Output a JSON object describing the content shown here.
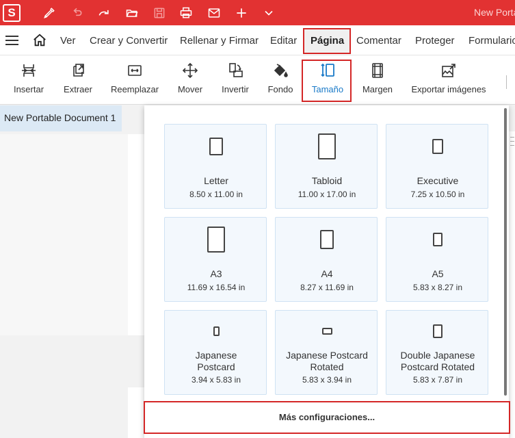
{
  "app": {
    "logo": "S",
    "document_title": "New Portable Document 1",
    "title_bar_text": "New Portable",
    "accent_color": "#e23232",
    "highlight_color": "#d42626",
    "active_color": "#1a7ac8"
  },
  "quick_access": [
    {
      "icon": "pen-icon"
    },
    {
      "icon": "undo-icon"
    },
    {
      "icon": "redo-icon"
    },
    {
      "icon": "open-folder-icon"
    },
    {
      "icon": "save-icon"
    },
    {
      "icon": "print-icon"
    },
    {
      "icon": "mail-icon"
    },
    {
      "icon": "plus-icon"
    },
    {
      "icon": "chevron-down-icon"
    }
  ],
  "menu": {
    "items": [
      "Ver",
      "Crear y Convertir",
      "Rellenar y Firmar",
      "Editar",
      "Página",
      "Comentar",
      "Proteger",
      "Formulario"
    ],
    "active": "Página"
  },
  "ribbon": {
    "tools": [
      "Insertar",
      "Extraer",
      "Reemplazar",
      "Mover",
      "Invertir",
      "Fondo",
      "Tamaño",
      "Margen",
      "Exportar imágenes"
    ],
    "active": "Tamaño"
  },
  "doc_tab": "New Portable Document 1",
  "sizes": [
    {
      "name": "Letter",
      "dims": "8.50 x 11.00 in"
    },
    {
      "name": "Tabloid",
      "dims": "11.00 x 17.00 in"
    },
    {
      "name": "Executive",
      "dims": "7.25 x 10.50 in"
    },
    {
      "name": "A3",
      "dims": "11.69 x 16.54 in"
    },
    {
      "name": "A4",
      "dims": "8.27 x 11.69 in"
    },
    {
      "name": "A5",
      "dims": "5.83 x 8.27 in"
    },
    {
      "name": "Japanese\nPostcard",
      "dims": "3.94 x 5.83 in"
    },
    {
      "name": "Japanese Postcard\nRotated",
      "dims": "5.83 x 3.94 in"
    },
    {
      "name": "Double Japanese\nPostcard Rotated",
      "dims": "5.83 x 7.87 in"
    }
  ],
  "more_settings": "Más configuraciones..."
}
